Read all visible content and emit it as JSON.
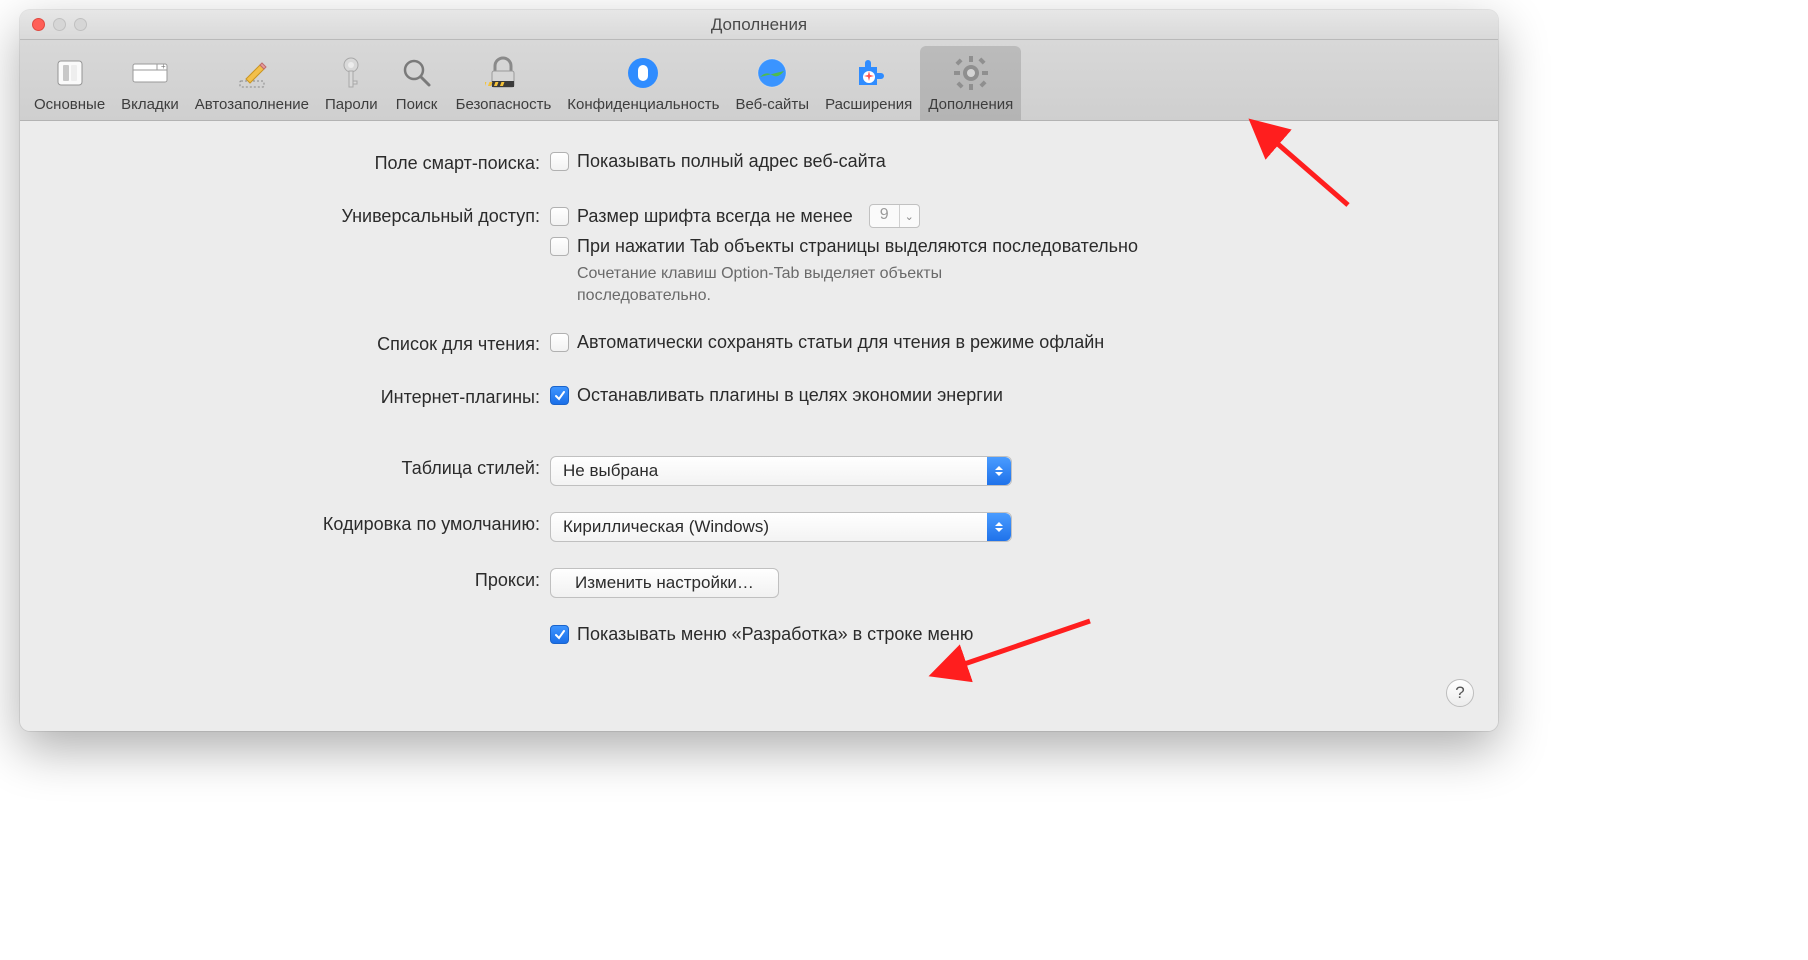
{
  "window": {
    "title": "Дополнения"
  },
  "toolbar": {
    "tabs": [
      {
        "label": "Основные"
      },
      {
        "label": "Вкладки"
      },
      {
        "label": "Автозаполнение"
      },
      {
        "label": "Пароли"
      },
      {
        "label": "Поиск"
      },
      {
        "label": "Безопасность"
      },
      {
        "label": "Конфиденциальность"
      },
      {
        "label": "Веб-сайты"
      },
      {
        "label": "Расширения"
      },
      {
        "label": "Дополнения"
      }
    ],
    "active_index": 9
  },
  "sections": {
    "smart_search": {
      "label": "Поле смарт-поиска:",
      "show_full_url": {
        "label": "Показывать полный адрес веб-сайта",
        "checked": false
      }
    },
    "accessibility": {
      "label": "Универсальный доступ:",
      "min_font": {
        "label": "Размер шрифта всегда не менее",
        "checked": false,
        "value": "9"
      },
      "tab_highlight": {
        "label": "При нажатии Tab объекты страницы выделяются последовательно",
        "checked": false
      },
      "tab_hint": "Сочетание клавиш Option-Tab выделяет объекты последовательно."
    },
    "reading_list": {
      "label": "Список для чтения:",
      "auto_save": {
        "label": "Автоматически сохранять статьи для чтения в режиме офлайн",
        "checked": false
      }
    },
    "plugins": {
      "label": "Интернет-плагины:",
      "stop_for_power": {
        "label": "Останавливать плагины в целях экономии энергии",
        "checked": true
      }
    },
    "stylesheet": {
      "label": "Таблица стилей:",
      "value": "Не выбрана"
    },
    "encoding": {
      "label": "Кодировка по умолчанию:",
      "value": "Кириллическая (Windows)"
    },
    "proxy": {
      "label": "Прокси:",
      "button": "Изменить настройки…"
    },
    "develop_menu": {
      "label": "Показывать меню «Разработка» в строке меню",
      "checked": true
    }
  },
  "help_button": "?"
}
